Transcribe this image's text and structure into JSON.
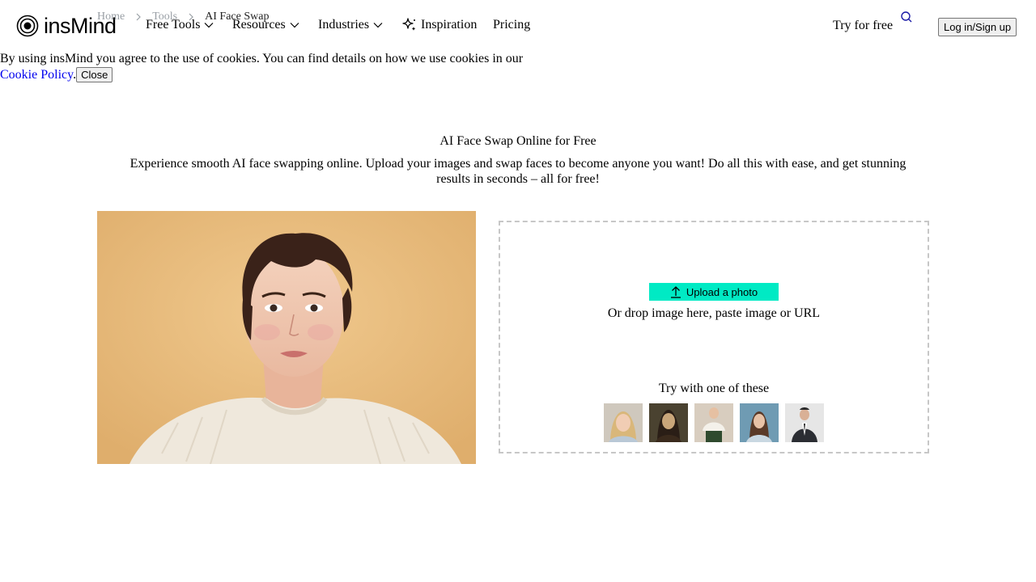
{
  "brand": {
    "name": "insMind"
  },
  "breadcrumb": {
    "home": "Home",
    "tools": "Tools",
    "current": "AI Face Swap"
  },
  "nav": {
    "free_tools": "Free Tools",
    "resources": "Resources",
    "industries": "Industries",
    "inspiration": "Inspiration",
    "pricing": "Pricing"
  },
  "header": {
    "try_free": "Try for free",
    "login": "Log in/Sign up"
  },
  "cookie": {
    "text": "By using insMind you agree to the use of cookies. You can find details on how we use cookies in our",
    "link": "Cookie Policy",
    "close": "Close"
  },
  "hero": {
    "title": "AI Face Swap Online for Free",
    "description": "Experience smooth AI face swapping online. Upload your images and swap faces to become anyone you want! Do all this with ease, and get stunning results in seconds – all for free!"
  },
  "upload": {
    "button": "Upload a photo",
    "drop_hint": "Or drop image here, paste image or URL",
    "try_label": "Try with one of these"
  },
  "colors": {
    "upload_button": "#00eac4",
    "link": "#0000ee",
    "breadcrumb_muted": "#9aa0a6",
    "panel_border": "#c7c7c7",
    "photo_background": "#e8bd80"
  }
}
